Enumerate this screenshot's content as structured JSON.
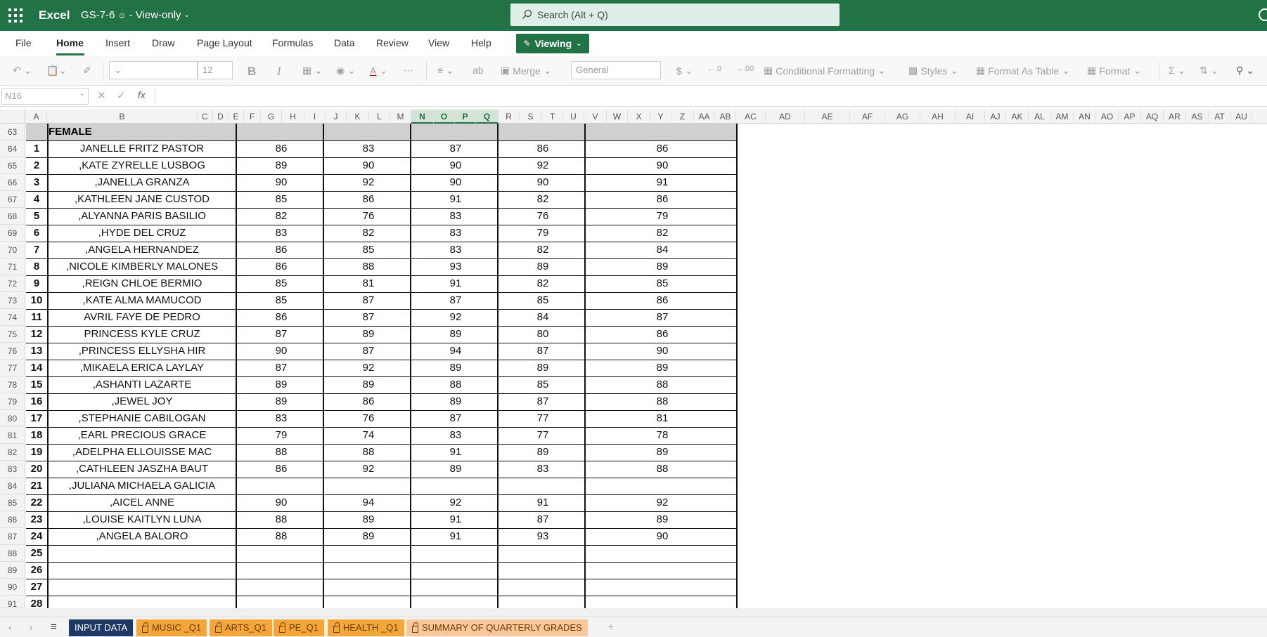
{
  "app": {
    "name": "Excel",
    "file_title": "GS-7-6",
    "mode": "- View-only"
  },
  "search": {
    "placeholder": "Search (Alt + Q)"
  },
  "menu": [
    "File",
    "Home",
    "Insert",
    "Draw",
    "Page Layout",
    "Formulas",
    "Data",
    "Review",
    "View",
    "Help"
  ],
  "viewing_button": "Viewing",
  "ribbon": {
    "font_size": "12",
    "bold": "B",
    "italic": "I",
    "merge": "Merge",
    "number_format": "General",
    "currency": "$",
    "conditional_formatting": "Conditional Formatting",
    "styles": "Styles",
    "format_as_table": "Format As Table",
    "format": "Format"
  },
  "formula_bar": {
    "name_box": "N16",
    "fx": "fx"
  },
  "columns": [
    "A",
    "B",
    "C",
    "D",
    "E",
    "F",
    "G",
    "H",
    "I",
    "J",
    "K",
    "L",
    "M",
    "N",
    "O",
    "P",
    "Q",
    "R",
    "S",
    "T",
    "U",
    "V",
    "W",
    "X",
    "Y",
    "Z",
    "AA",
    "AB",
    "AC",
    "AD",
    "AE",
    "AF",
    "AG",
    "AH",
    "AI",
    "AJ",
    "AK",
    "AL",
    "AM",
    "AN",
    "AO",
    "AP",
    "AQ",
    "AR",
    "AS",
    "AT",
    "AU"
  ],
  "row_numbers": [
    "63",
    "64",
    "65",
    "66",
    "67",
    "68",
    "69",
    "70",
    "71",
    "72",
    "73",
    "74",
    "75",
    "76",
    "77",
    "78",
    "79",
    "80",
    "81",
    "82",
    "83",
    "84",
    "85",
    "86",
    "87",
    "88",
    "89",
    "90",
    "91"
  ],
  "section_label": "FEMALE",
  "students": [
    {
      "no": "1",
      "name": "JANELLE FRITZ PASTOR",
      "g1": "86",
      "g2": "83",
      "g3": "87",
      "g4": "86",
      "avg": "86"
    },
    {
      "no": "2",
      "name": ",KATE ZYRELLE LUSBOG",
      "g1": "89",
      "g2": "90",
      "g3": "90",
      "g4": "92",
      "avg": "90"
    },
    {
      "no": "3",
      "name": ",JANELLA GRANZA",
      "g1": "90",
      "g2": "92",
      "g3": "90",
      "g4": "90",
      "avg": "91"
    },
    {
      "no": "4",
      "name": ",KATHLEEN JANE CUSTOD",
      "g1": "85",
      "g2": "86",
      "g3": "91",
      "g4": "82",
      "avg": "86"
    },
    {
      "no": "5",
      "name": ",ALYANNA PARIS BASILIO",
      "g1": "82",
      "g2": "76",
      "g3": "83",
      "g4": "76",
      "avg": "79"
    },
    {
      "no": "6",
      "name": ",HYDE DEL CRUZ",
      "g1": "83",
      "g2": "82",
      "g3": "83",
      "g4": "79",
      "avg": "82"
    },
    {
      "no": "7",
      "name": ",ANGELA HERNANDEZ",
      "g1": "86",
      "g2": "85",
      "g3": "83",
      "g4": "82",
      "avg": "84"
    },
    {
      "no": "8",
      "name": ",NICOLE KIMBERLY MALONES",
      "g1": "86",
      "g2": "88",
      "g3": "93",
      "g4": "89",
      "avg": "89"
    },
    {
      "no": "9",
      "name": ",REIGN CHLOE BERMIO",
      "g1": "85",
      "g2": "81",
      "g3": "91",
      "g4": "82",
      "avg": "85"
    },
    {
      "no": "10",
      "name": ",KATE ALMA MAMUCOD",
      "g1": "85",
      "g2": "87",
      "g3": "87",
      "g4": "85",
      "avg": "86"
    },
    {
      "no": "11",
      "name": "AVRIL FAYE DE PEDRO",
      "g1": "86",
      "g2": "87",
      "g3": "92",
      "g4": "84",
      "avg": "87"
    },
    {
      "no": "12",
      "name": "PRINCESS KYLE CRUZ",
      "g1": "87",
      "g2": "89",
      "g3": "89",
      "g4": "80",
      "avg": "86"
    },
    {
      "no": "13",
      "name": ",PRINCESS ELLYSHA HIR",
      "g1": "90",
      "g2": "87",
      "g3": "94",
      "g4": "87",
      "avg": "90"
    },
    {
      "no": "14",
      "name": ",MIKAELA ERICA LAYLAY",
      "g1": "87",
      "g2": "92",
      "g3": "89",
      "g4": "89",
      "avg": "89"
    },
    {
      "no": "15",
      "name": ",ASHANTI LAZARTE",
      "g1": "89",
      "g2": "89",
      "g3": "88",
      "g4": "85",
      "avg": "88"
    },
    {
      "no": "16",
      "name": ",JEWEL JOY",
      "g1": "89",
      "g2": "86",
      "g3": "89",
      "g4": "87",
      "avg": "88"
    },
    {
      "no": "17",
      "name": ",STEPHANIE CABILOGAN",
      "g1": "83",
      "g2": "76",
      "g3": "87",
      "g4": "77",
      "avg": "81"
    },
    {
      "no": "18",
      "name": ",EARL PRECIOUS GRACE",
      "g1": "79",
      "g2": "74",
      "g3": "83",
      "g4": "77",
      "avg": "78"
    },
    {
      "no": "19",
      "name": ",ADELPHA ELLOUISSE MAC",
      "g1": "88",
      "g2": "88",
      "g3": "91",
      "g4": "89",
      "avg": "89"
    },
    {
      "no": "20",
      "name": ",CATHLEEN JASZHA BAUT",
      "g1": "86",
      "g2": "92",
      "g3": "89",
      "g4": "83",
      "avg": "88"
    },
    {
      "no": "21",
      "name": ",JULIANA MICHAELA GALICIA",
      "g1": "",
      "g2": "",
      "g3": "",
      "g4": "",
      "avg": ""
    },
    {
      "no": "22",
      "name": ",AICEL ANNE",
      "g1": "90",
      "g2": "94",
      "g3": "92",
      "g4": "91",
      "avg": "92"
    },
    {
      "no": "23",
      "name": ",LOUISE KAITLYN LUNA",
      "g1": "88",
      "g2": "89",
      "g3": "91",
      "g4": "87",
      "avg": "89"
    },
    {
      "no": "24",
      "name": ",ANGELA BALORO",
      "g1": "88",
      "g2": "89",
      "g3": "91",
      "g4": "93",
      "avg": "90"
    },
    {
      "no": "25",
      "name": "",
      "g1": "",
      "g2": "",
      "g3": "",
      "g4": "",
      "avg": ""
    },
    {
      "no": "26",
      "name": "",
      "g1": "",
      "g2": "",
      "g3": "",
      "g4": "",
      "avg": ""
    },
    {
      "no": "27",
      "name": "",
      "g1": "",
      "g2": "",
      "g3": "",
      "g4": "",
      "avg": ""
    },
    {
      "no": "28",
      "name": "",
      "g1": "",
      "g2": "",
      "g3": "",
      "g4": "",
      "avg": ""
    }
  ],
  "sheet_tabs": [
    {
      "label": "INPUT DATA",
      "style": "active",
      "locked": false
    },
    {
      "label": "MUSIC _Q1",
      "style": "orange",
      "locked": true
    },
    {
      "label": "ARTS_Q1",
      "style": "orange",
      "locked": true
    },
    {
      "label": "PE_Q1",
      "style": "orange",
      "locked": true
    },
    {
      "label": "HEALTH _Q1",
      "style": "orange",
      "locked": true
    },
    {
      "label": "SUMMARY OF QUARTERLY GRADES",
      "style": "light",
      "locked": true
    }
  ],
  "colors": {
    "brand": "#217346",
    "tab_active": "#203864",
    "tab_orange": "#f4a63a",
    "tab_light": "#f8c79a"
  }
}
